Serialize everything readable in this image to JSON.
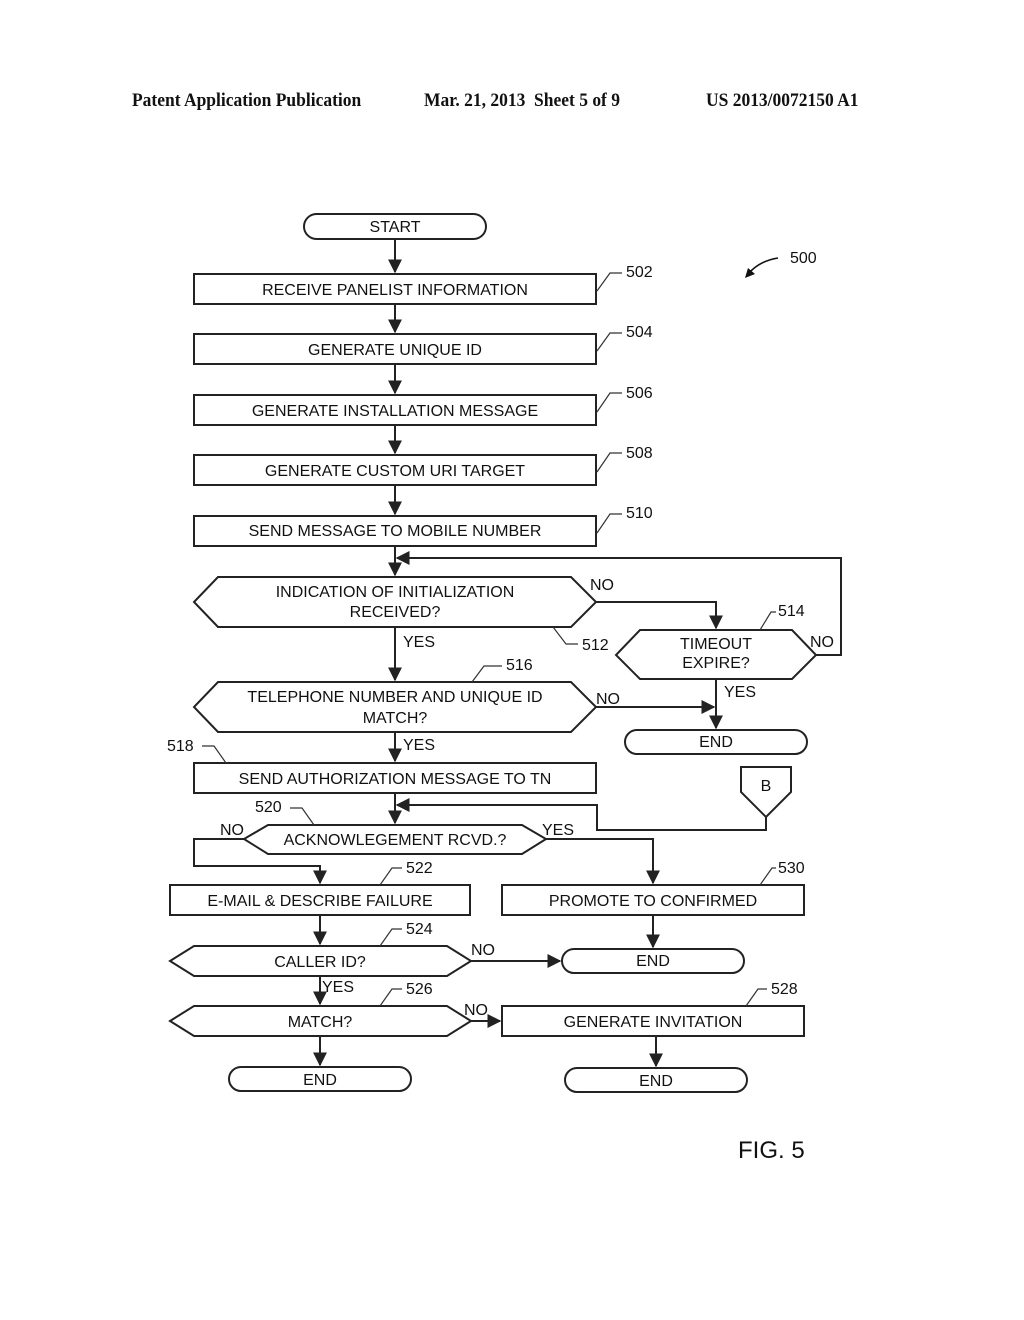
{
  "header": {
    "publication_type": "Patent Application Publication",
    "date_sheet": "Mar. 21, 2013  Sheet 5 of 9",
    "patent_number": "US 2013/0072150 A1"
  },
  "figure": {
    "label": "FIG. 5",
    "ref_number": "500"
  },
  "nodes": {
    "start": {
      "text": "START"
    },
    "n502": {
      "text": "RECEIVE PANELIST INFORMATION",
      "ref": "502"
    },
    "n504": {
      "text": "GENERATE UNIQUE ID",
      "ref": "504"
    },
    "n506": {
      "text": "GENERATE INSTALLATION MESSAGE",
      "ref": "506"
    },
    "n508": {
      "text": "GENERATE CUSTOM URI TARGET",
      "ref": "508"
    },
    "n510": {
      "text": "SEND MESSAGE TO MOBILE NUMBER",
      "ref": "510"
    },
    "n512": {
      "line1": "INDICATION OF INITIALIZATION",
      "line2": "RECEIVED?",
      "ref": "512"
    },
    "n514": {
      "line1": "TIMEOUT",
      "line2": "EXPIRE?",
      "ref": "514"
    },
    "n516": {
      "line1": "TELEPHONE NUMBER AND UNIQUE ID",
      "line2": "MATCH?",
      "ref": "516"
    },
    "end1": {
      "text": "END"
    },
    "n518": {
      "text": "SEND AUTHORIZATION MESSAGE TO TN",
      "ref": "518"
    },
    "connB": {
      "text": "B"
    },
    "n520": {
      "text": "ACKNOWLEGEMENT RCVD.?",
      "ref": "520"
    },
    "n522": {
      "text": "E-MAIL & DESCRIBE FAILURE",
      "ref": "522"
    },
    "n530": {
      "text": "PROMOTE TO CONFIRMED",
      "ref": "530"
    },
    "n524": {
      "text": "CALLER ID?",
      "ref": "524"
    },
    "end2": {
      "text": "END"
    },
    "n526": {
      "text": "MATCH?",
      "ref": "526"
    },
    "n528": {
      "text": "GENERATE INVITATION",
      "ref": "528"
    },
    "end3": {
      "text": "END"
    },
    "end4": {
      "text": "END"
    }
  },
  "edge_labels": {
    "e512_no": "NO",
    "e512_yes": "YES",
    "e514_no": "NO",
    "e514_yes": "YES",
    "e516_no": "NO",
    "e516_yes": "YES",
    "e520_no": "NO",
    "e520_yes": "YES",
    "e524_no": "NO",
    "e524_yes": "YES",
    "e526_no": "NO"
  }
}
